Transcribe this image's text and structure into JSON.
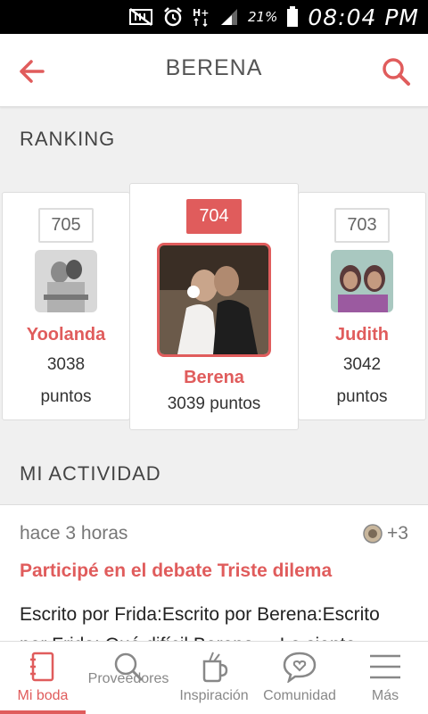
{
  "status_bar": {
    "battery_percent": "21%",
    "time": "08:04 PM"
  },
  "header": {
    "title": "BERENA",
    "icons": {
      "back": "arrow-left-icon",
      "search": "search-icon"
    },
    "accent_color": "#e05c5c"
  },
  "ranking": {
    "section_title": "RANKING",
    "entries": [
      {
        "rank": "705",
        "name": "Yoolanda",
        "points": "3038",
        "points_unit": "puntos"
      },
      {
        "rank": "704",
        "name": "Berena",
        "points_text": "3039 puntos"
      },
      {
        "rank": "703",
        "name": "Judith",
        "points": "3042",
        "points_unit": "puntos"
      }
    ]
  },
  "activity": {
    "section_title": "MI ACTIVIDAD",
    "time": "hace 3 horas",
    "count": "+3",
    "link": "Participé en el debate Triste dilema",
    "body": "Escrito por Frida:Escrito por Berena:Escrito por Frida: Qué difícil Berena,... Lo siento."
  },
  "bottom_nav": {
    "items": [
      {
        "label": "Mi boda",
        "icon": "notebook-icon",
        "active": true
      },
      {
        "label": "Proveedores",
        "icon": "search-icon",
        "active": false
      },
      {
        "label": "Inspiración",
        "icon": "mug-icon",
        "active": false
      },
      {
        "label": "Comunidad",
        "icon": "chat-heart-icon",
        "active": false
      },
      {
        "label": "Más",
        "icon": "menu-icon",
        "active": false
      }
    ]
  }
}
